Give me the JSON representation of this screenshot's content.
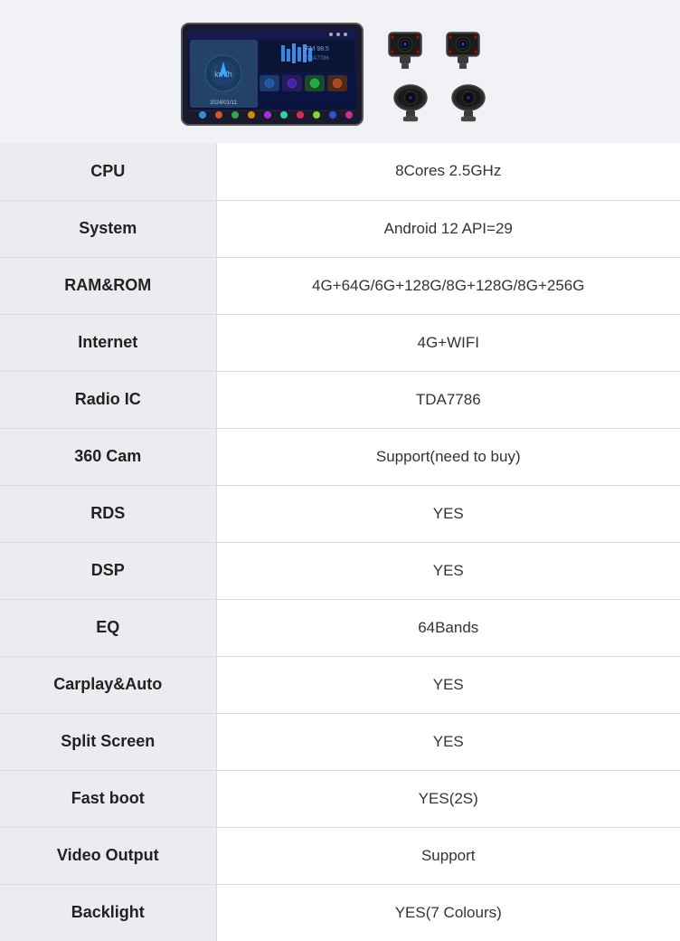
{
  "product": {
    "image_alt": "Car Android Head Unit"
  },
  "specs": [
    {
      "label": "CPU",
      "value": "8Cores  2.5GHz"
    },
    {
      "label": "System",
      "value": "Android 12  API=29"
    },
    {
      "label": "RAM&ROM",
      "value": "4G+64G/6G+128G/8G+128G/8G+256G"
    },
    {
      "label": "Internet",
      "value": "4G+WIFI"
    },
    {
      "label": "Radio IC",
      "value": "TDA7786"
    },
    {
      "label": "360 Cam",
      "value": "Support(need to buy)"
    },
    {
      "label": "RDS",
      "value": "YES"
    },
    {
      "label": "DSP",
      "value": "YES"
    },
    {
      "label": "EQ",
      "value": "64Bands"
    },
    {
      "label": "Carplay&Auto",
      "value": "YES"
    },
    {
      "label": "Split Screen",
      "value": "YES"
    },
    {
      "label": "Fast boot",
      "value": "YES(2S)"
    },
    {
      "label": "Video Output",
      "value": "Support"
    },
    {
      "label": "Backlight",
      "value": "YES(7 Colours)"
    }
  ]
}
